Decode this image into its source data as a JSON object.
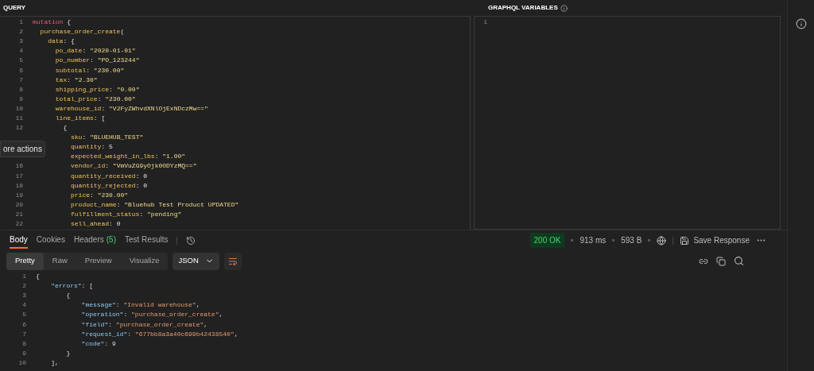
{
  "query": {
    "title": "QUERY",
    "lines": [
      {
        "number": "1",
        "tokens": [
          {
            "kind": "keyword",
            "text": "mutation"
          },
          {
            "kind": "punct",
            "text": " {"
          }
        ]
      },
      {
        "number": "2",
        "tokens": [
          {
            "kind": "key",
            "text": "  purchase_order_create"
          },
          {
            "kind": "punct",
            "text": "("
          }
        ]
      },
      {
        "number": "3",
        "tokens": [
          {
            "kind": "key",
            "text": "    data"
          },
          {
            "kind": "punct",
            "text": ": {"
          }
        ]
      },
      {
        "number": "4",
        "tokens": [
          {
            "kind": "key",
            "text": "      po_date"
          },
          {
            "kind": "punct",
            "text": ": "
          },
          {
            "kind": "string",
            "text": "\"2020-01-01\""
          }
        ]
      },
      {
        "number": "5",
        "tokens": [
          {
            "kind": "key",
            "text": "      po_number"
          },
          {
            "kind": "punct",
            "text": ": "
          },
          {
            "kind": "string",
            "text": "\"PO_123244\""
          }
        ]
      },
      {
        "number": "6",
        "tokens": [
          {
            "kind": "key",
            "text": "      subtotal"
          },
          {
            "kind": "punct",
            "text": ": "
          },
          {
            "kind": "string",
            "text": "\"230.00\""
          }
        ]
      },
      {
        "number": "7",
        "tokens": [
          {
            "kind": "key",
            "text": "      tax"
          },
          {
            "kind": "punct",
            "text": ": "
          },
          {
            "kind": "string",
            "text": "\"2.30\""
          }
        ]
      },
      {
        "number": "8",
        "tokens": [
          {
            "kind": "key",
            "text": "      shipping_price"
          },
          {
            "kind": "punct",
            "text": ": "
          },
          {
            "kind": "string",
            "text": "\"0.00\""
          }
        ]
      },
      {
        "number": "9",
        "tokens": [
          {
            "kind": "key",
            "text": "      total_price"
          },
          {
            "kind": "punct",
            "text": ": "
          },
          {
            "kind": "string",
            "text": "\"230.00\""
          }
        ]
      },
      {
        "number": "10",
        "tokens": [
          {
            "kind": "key",
            "text": "      warehouse_id"
          },
          {
            "kind": "punct",
            "text": ": "
          },
          {
            "kind": "string",
            "text": "\"V2FyZWhvdXNlOjExNDczMw==\""
          }
        ]
      },
      {
        "number": "11",
        "tokens": [
          {
            "kind": "key",
            "text": "      line_items"
          },
          {
            "kind": "punct",
            "text": ": ["
          }
        ]
      },
      {
        "number": "12",
        "tokens": [
          {
            "kind": "punct",
            "text": "        {"
          }
        ]
      },
      {
        "tokens": [
          {
            "kind": "key",
            "text": "          sku"
          },
          {
            "kind": "punct",
            "text": ": "
          },
          {
            "kind": "string",
            "text": "\"BLUEHUB_TEST\""
          }
        ]
      },
      {
        "tokens": [
          {
            "kind": "key",
            "text": "          quantity"
          },
          {
            "kind": "punct",
            "text": ": "
          },
          {
            "kind": "number",
            "text": "5"
          }
        ]
      },
      {
        "tokens": [
          {
            "kind": "key",
            "text": "          expected_weight_in_lbs"
          },
          {
            "kind": "punct",
            "text": ": "
          },
          {
            "kind": "string",
            "text": "\"1.00\""
          }
        ]
      },
      {
        "number": "16",
        "tokens": [
          {
            "kind": "key",
            "text": "          vendor_id"
          },
          {
            "kind": "punct",
            "text": ": "
          },
          {
            "kind": "string",
            "text": "\"VmVuZG9yOjk0ODYzMQ==\""
          }
        ]
      },
      {
        "number": "17",
        "tokens": [
          {
            "kind": "key",
            "text": "          quantity_received"
          },
          {
            "kind": "punct",
            "text": ": "
          },
          {
            "kind": "number",
            "text": "0"
          }
        ]
      },
      {
        "number": "18",
        "tokens": [
          {
            "kind": "key",
            "text": "          quantity_rejected"
          },
          {
            "kind": "punct",
            "text": ": "
          },
          {
            "kind": "number",
            "text": "0"
          }
        ]
      },
      {
        "number": "19",
        "tokens": [
          {
            "kind": "key",
            "text": "          price"
          },
          {
            "kind": "punct",
            "text": ": "
          },
          {
            "kind": "string",
            "text": "\"230.00\""
          }
        ]
      },
      {
        "number": "20",
        "tokens": [
          {
            "kind": "key",
            "text": "          product_name"
          },
          {
            "kind": "punct",
            "text": ": "
          },
          {
            "kind": "string",
            "text": "\"Bluehub Test Product UPDATED\""
          }
        ]
      },
      {
        "number": "21",
        "tokens": [
          {
            "kind": "key",
            "text": "          fulfillment_status"
          },
          {
            "kind": "punct",
            "text": ": "
          },
          {
            "kind": "string",
            "text": "\"pending\""
          }
        ]
      },
      {
        "number": "22",
        "tokens": [
          {
            "kind": "key",
            "text": "          sell_ahead"
          },
          {
            "kind": "punct",
            "text": ": "
          },
          {
            "kind": "number",
            "text": "0"
          }
        ]
      }
    ]
  },
  "tooltip": {
    "text": "ore actions"
  },
  "variables": {
    "title": "GRAPHQL VARIABLES",
    "lines": [
      {
        "number": "1"
      }
    ]
  },
  "response": {
    "tabs": [
      {
        "label": "Body",
        "selected": true
      },
      {
        "label": "Cookies",
        "selected": false
      },
      {
        "label": "Headers",
        "count": "(5)",
        "selected": false
      },
      {
        "label": "Test Results",
        "selected": false
      }
    ],
    "status": {
      "code": "200 OK",
      "time": "913 ms",
      "size": "593 B"
    },
    "save_label": "Save Response",
    "view_modes": [
      {
        "label": "Pretty",
        "selected": true
      },
      {
        "label": "Raw",
        "selected": false
      },
      {
        "label": "Preview",
        "selected": false
      },
      {
        "label": "Visualize",
        "selected": false
      }
    ],
    "format": "JSON",
    "lines": [
      {
        "number": "1",
        "tokens": [
          {
            "kind": "punct",
            "text": "{"
          }
        ]
      },
      {
        "number": "2",
        "tokens": [
          {
            "kind": "key",
            "text": "    \"errors\""
          },
          {
            "kind": "punct",
            "text": ": ["
          }
        ]
      },
      {
        "number": "3",
        "tokens": [
          {
            "kind": "punct",
            "text": "        {"
          }
        ]
      },
      {
        "number": "4",
        "tokens": [
          {
            "kind": "key",
            "text": "            \"message\""
          },
          {
            "kind": "punct",
            "text": ": "
          },
          {
            "kind": "string",
            "text": "\"Invalid warehouse\""
          },
          {
            "kind": "punct",
            "text": ","
          }
        ]
      },
      {
        "number": "5",
        "tokens": [
          {
            "kind": "key",
            "text": "            \"operation\""
          },
          {
            "kind": "punct",
            "text": ": "
          },
          {
            "kind": "string",
            "text": "\"purchase_order_create\""
          },
          {
            "kind": "punct",
            "text": ","
          }
        ]
      },
      {
        "number": "6",
        "tokens": [
          {
            "kind": "key",
            "text": "            \"field\""
          },
          {
            "kind": "punct",
            "text": ": "
          },
          {
            "kind": "string",
            "text": "\"purchase_order_create\""
          },
          {
            "kind": "punct",
            "text": ","
          }
        ]
      },
      {
        "number": "7",
        "tokens": [
          {
            "kind": "key",
            "text": "            \"request_id\""
          },
          {
            "kind": "punct",
            "text": ": "
          },
          {
            "kind": "string",
            "text": "\"677bb8a3a40c699b42438540\""
          },
          {
            "kind": "punct",
            "text": ","
          }
        ]
      },
      {
        "number": "8",
        "tokens": [
          {
            "kind": "key",
            "text": "            \"code\""
          },
          {
            "kind": "punct",
            "text": ": "
          },
          {
            "kind": "number",
            "text": "9"
          }
        ]
      },
      {
        "number": "9",
        "tokens": [
          {
            "kind": "punct",
            "text": "        }"
          }
        ]
      },
      {
        "number": "10",
        "tokens": [
          {
            "kind": "punct",
            "text": "    ],"
          }
        ]
      }
    ]
  }
}
